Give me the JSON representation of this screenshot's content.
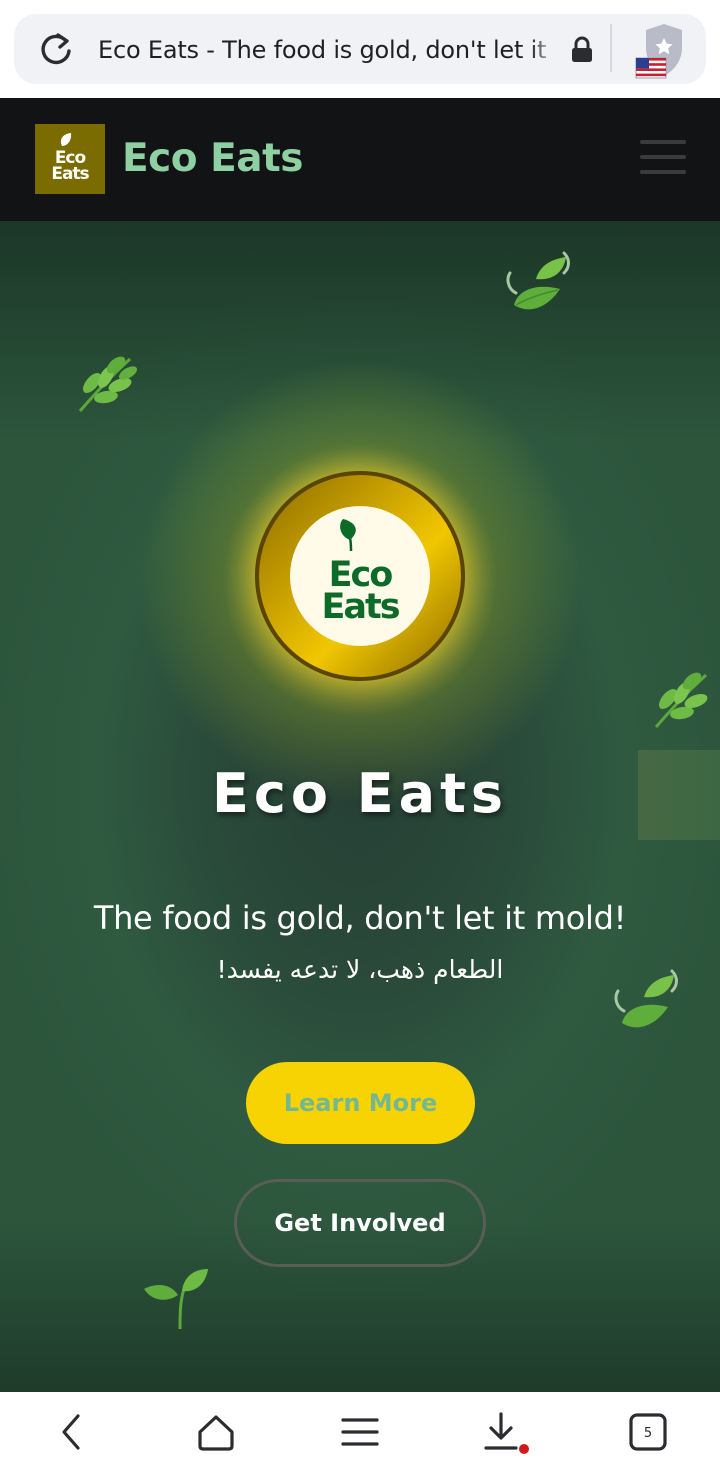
{
  "browser": {
    "url_title": "Eco Eats - The food is gold, don't let it mold!",
    "icons": {
      "reload": "reload-icon",
      "lock": "lock-icon",
      "flag": "us-flag-icon",
      "shield": "vpn-shield-icon"
    }
  },
  "header": {
    "logo_line1": "Eco",
    "logo_line2": "Eats",
    "brand_name": "Eco Eats",
    "menu_icon": "hamburger-menu-icon"
  },
  "hero": {
    "emblem_line1": "Eco",
    "emblem_line2": "Eats",
    "title": "Eco Eats",
    "tagline": "The food is gold, don't let it mold!",
    "tagline_arabic": "الطعام ذهب، لا تدعه يفسد!",
    "learn_more_label": "Learn More",
    "get_involved_label": "Get Involved"
  },
  "bottom_nav": {
    "icons": [
      "back-icon",
      "home-icon",
      "menu-icon",
      "download-icon",
      "tabs-icon"
    ],
    "tabs_count": "5"
  },
  "colors": {
    "header_bg": "#121314",
    "brand_green": "#8fd0a3",
    "logo_gold": "#7a6c00",
    "button_yellow": "#f7d303",
    "hero_green": "#2c553c",
    "emblem_text_green": "#0d6b2a"
  }
}
